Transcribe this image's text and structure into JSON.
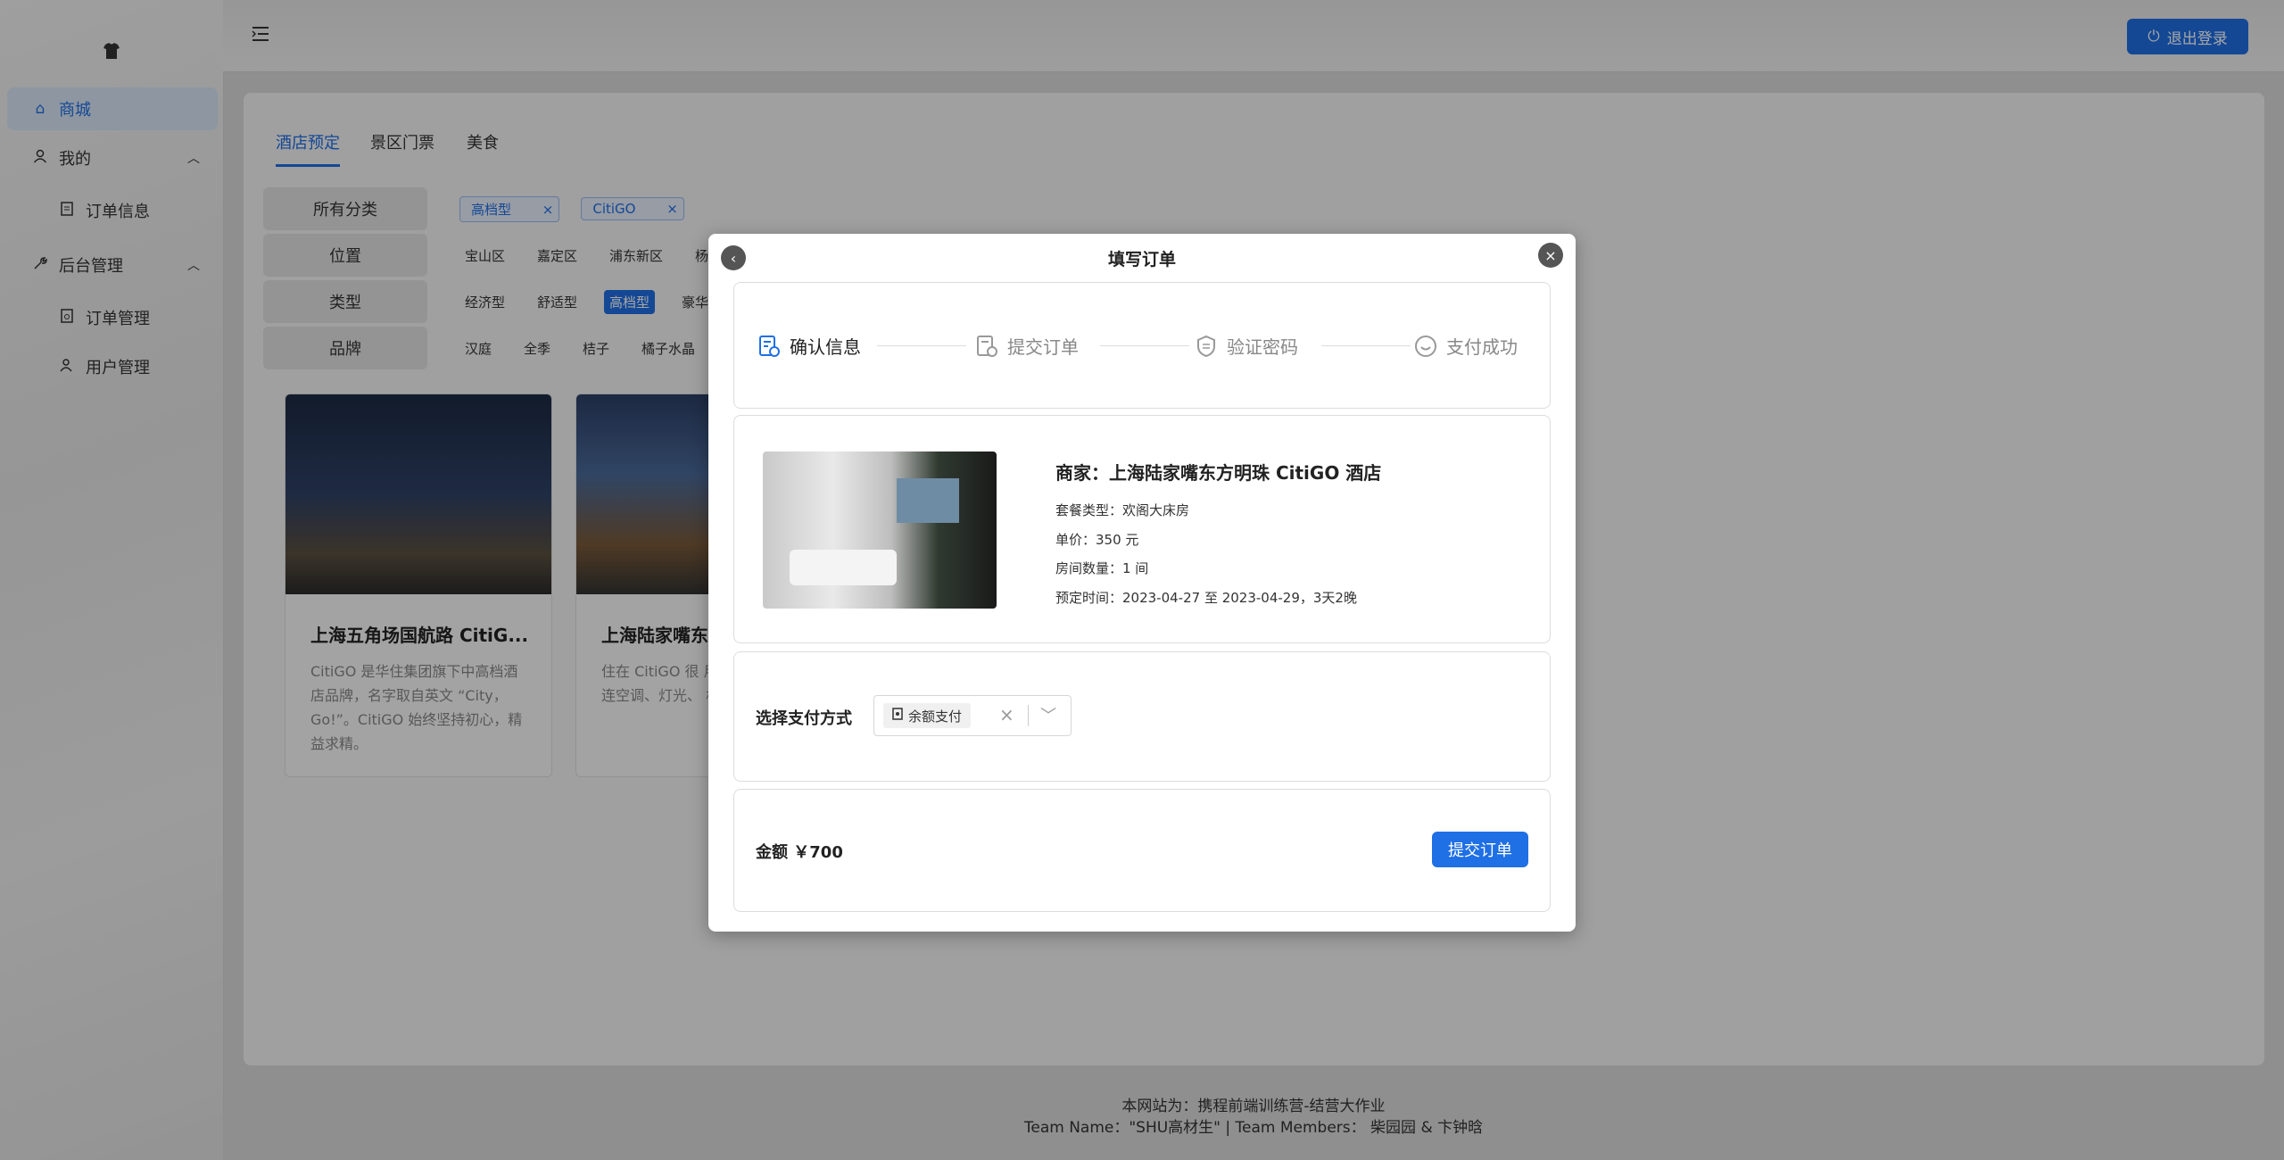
{
  "colors": {
    "accent": "#1f6fe5",
    "overlay": "rgba(0,0,0,0.35)"
  },
  "sidebar": {
    "logo_icon": "tshirt-icon",
    "items": [
      {
        "label": "商城",
        "icon": "shop-icon"
      },
      {
        "label": "我的",
        "icon": "user-icon"
      },
      {
        "label": "订单信息",
        "icon": "document-icon"
      },
      {
        "label": "后台管理",
        "icon": "wrench-icon"
      },
      {
        "label": "订单管理",
        "icon": "order-icon"
      },
      {
        "label": "用户管理",
        "icon": "users-icon"
      }
    ]
  },
  "header": {
    "menu_icon": "menu-toggle-icon",
    "logout_label": "退出登录"
  },
  "tabs": [
    "酒店预定",
    "景区门票",
    "美食"
  ],
  "filters": {
    "all_label": "所有分类",
    "selected_tags": [
      "高档型",
      "CitiGO"
    ],
    "location_label": "位置",
    "locations": [
      "宝山区",
      "嘉定区",
      "浦东新区",
      "杨浦"
    ],
    "type_label": "类型",
    "types": [
      "经济型",
      "舒适型",
      "高档型",
      "豪华型"
    ],
    "brand_label": "品牌",
    "brands": [
      "汉庭",
      "全季",
      "桔子",
      "橘子水晶"
    ]
  },
  "hotels": [
    {
      "title": "上海五角场国航路 CitiG...",
      "desc": "CitiGO 是华住集团旗下中高档酒店品牌，名字取自英文 “City，Go!”。CitiGO 始终坚持初心，精益求精。"
    },
    {
      "title": "上海陆家嘴东",
      "desc": "住在 CitiGO 很 用房卡，看电视 连空调、灯光、 机智能控制。"
    }
  ],
  "footer": {
    "line1": "本网站为：携程前端训练营-结营大作业",
    "line2": "Team Name：\"SHU高材生\" | Team Members： 柴园园 & 卞钟晗"
  },
  "modal": {
    "title": "填写订单",
    "steps": [
      "确认信息",
      "提交订单",
      "验证密码",
      "支付成功"
    ],
    "merchant": "商家：上海陆家嘴东方明珠 CitiGO 酒店",
    "package": "套餐类型：欢阁大床房",
    "price": "单价：350 元",
    "rooms": "房间数量：1 间",
    "dates": "预定时间：2023-04-27 至 2023-04-29，3天2晚",
    "pay_label": "选择支付方式",
    "pay_method": "余额支付",
    "amount": "金额 ￥700",
    "submit_label": "提交订单"
  }
}
